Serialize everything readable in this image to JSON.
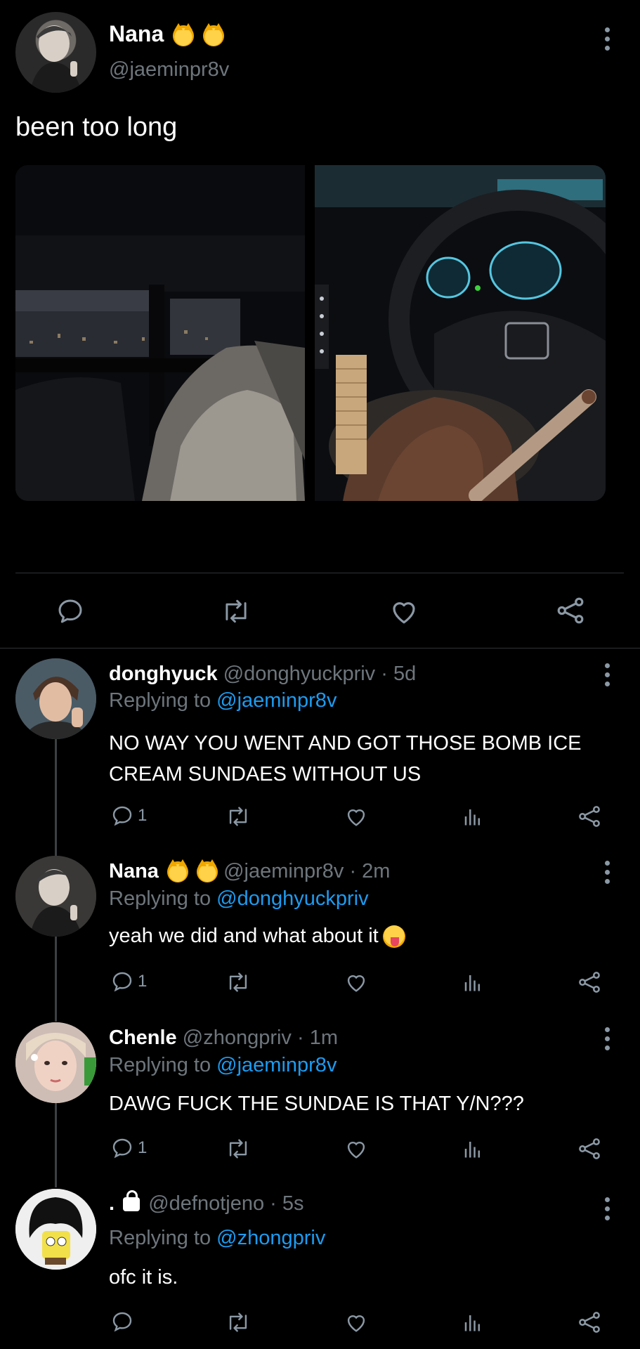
{
  "main_tweet": {
    "author_name": "Nana",
    "author_handle": "@jaeminpr8v",
    "text": "been too long",
    "emojis": [
      "kissing-cat",
      "kissing-cat"
    ]
  },
  "replies": [
    {
      "name": "donghyuck",
      "handle": "@donghyuckpriv",
      "time": "· 5d",
      "replying_label": "Replying to",
      "replying_to": "@jaeminpr8v",
      "text": "NO WAY YOU WENT AND GOT THOSE BOMB ICE CREAM SUNDAES WITHOUT US",
      "reply_count": "1"
    },
    {
      "name": "Nana",
      "handle": "@jaeminpr8v",
      "time": "· 2m",
      "replying_label": "Replying to",
      "replying_to": "@donghyuckpriv",
      "text": "yeah we did and what about it",
      "reply_count": "1"
    },
    {
      "name": "Chenle",
      "handle": "@zhongpriv",
      "time": "· 1m",
      "replying_label": "Replying to",
      "replying_to": "@jaeminpr8v",
      "text": "DAWG FUCK THE SUNDAE IS THAT Y/N???",
      "reply_count": "1"
    },
    {
      "name": ".",
      "handle": "@defnotjeno",
      "time": "· 5s",
      "replying_label": "Replying to",
      "replying_to": "@zhongpriv",
      "text": "ofc it is.",
      "reply_count": ""
    }
  ],
  "colors": {
    "background": "#000000",
    "text": "#ffffff",
    "muted": "#6e767d",
    "link": "#1d9bf0",
    "icon": "#8b98a5"
  }
}
